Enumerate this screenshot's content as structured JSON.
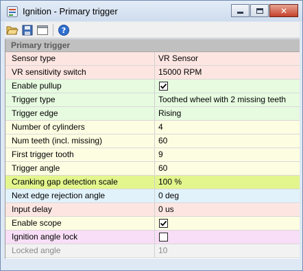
{
  "window": {
    "title": "Ignition - Primary trigger"
  },
  "toolbar": {
    "buttons": [
      {
        "icon": "open-folder-icon"
      },
      {
        "icon": "save-icon"
      },
      {
        "icon": "window-icon"
      },
      {
        "icon": "help-icon"
      }
    ]
  },
  "grid": {
    "group_title": "Primary trigger",
    "rows": [
      {
        "name": "Sensor type",
        "value": "VR Sensor",
        "type": "text",
        "color": "#fde6e2"
      },
      {
        "name": "VR sensitivity switch",
        "value": "15000 RPM",
        "type": "text",
        "color": "#fde6e2"
      },
      {
        "name": "Enable pullup",
        "value": "",
        "checked": true,
        "type": "checkbox",
        "color": "#e6fbe0"
      },
      {
        "name": "Trigger type",
        "value": "Toothed wheel with 2 missing teeth",
        "type": "text",
        "color": "#e6fbe0"
      },
      {
        "name": "Trigger edge",
        "value": "Rising",
        "type": "text",
        "color": "#e6fbe0"
      },
      {
        "name": "Number of cylinders",
        "value": "4",
        "type": "text",
        "color": "#fdfde2"
      },
      {
        "name": "Num teeth (incl. missing)",
        "value": "60",
        "type": "text",
        "color": "#fdfde2"
      },
      {
        "name": "First trigger tooth",
        "value": "9",
        "type": "text",
        "color": "#fdfde2"
      },
      {
        "name": "Trigger angle",
        "value": "60",
        "type": "text",
        "color": "#fdfde2"
      },
      {
        "name": "Cranking gap detection scale",
        "value": "100 %",
        "type": "text",
        "color": "#e3f58d"
      },
      {
        "name": "Next edge rejection angle",
        "value": "0 deg",
        "type": "text",
        "color": "#e1f2fb"
      },
      {
        "name": "Input delay",
        "value": "0 us",
        "type": "text",
        "color": "#fde6e2"
      },
      {
        "name": "Enable scope",
        "value": "",
        "checked": true,
        "type": "checkbox",
        "color": "#fdfde2"
      },
      {
        "name": "Ignition angle lock",
        "value": "",
        "checked": false,
        "type": "checkbox",
        "color": "#f8def6"
      },
      {
        "name": "Locked angle",
        "value": "10",
        "type": "text",
        "color": "#f2f2f2",
        "disabled": true
      }
    ]
  }
}
